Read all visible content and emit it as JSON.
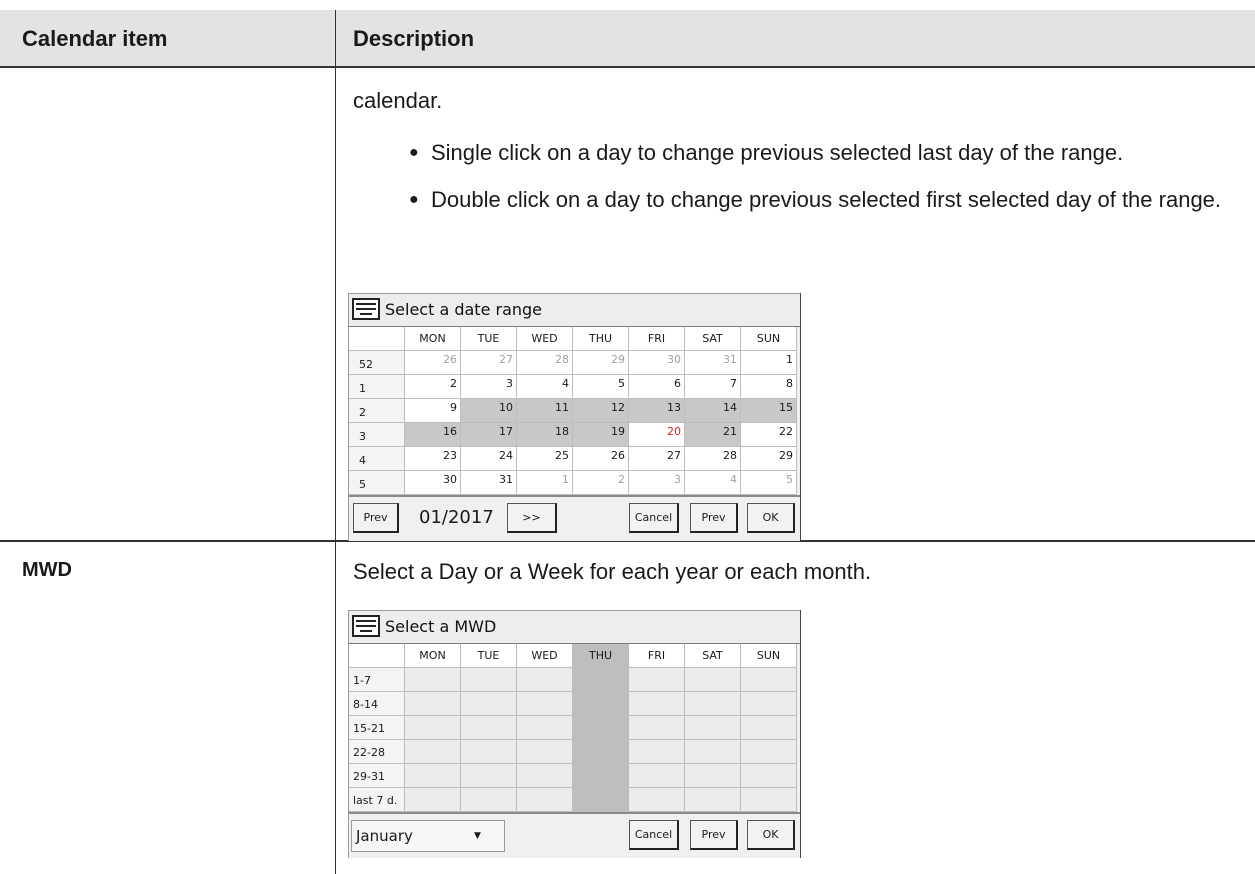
{
  "table": {
    "headers": [
      "Calendar item",
      "Description"
    ]
  },
  "row1": {
    "lead_text": "calendar.",
    "bullets": [
      "Single click on a day to change previous selected last day of the range.",
      "Double click on a day to change previous selected first selected day of the range."
    ]
  },
  "range_widget": {
    "title": "Select a date range",
    "day_headers": [
      "MON",
      "TUE",
      "WED",
      "THU",
      "FRI",
      "SAT",
      "SUN"
    ],
    "weeks": [
      {
        "week": "52",
        "days": [
          "26",
          "27",
          "28",
          "29",
          "30",
          "31",
          "1"
        ]
      },
      {
        "week": "1",
        "days": [
          "2",
          "3",
          "4",
          "5",
          "6",
          "7",
          "8"
        ]
      },
      {
        "week": "2",
        "days": [
          "9",
          "10",
          "11",
          "12",
          "13",
          "14",
          "15"
        ]
      },
      {
        "week": "3",
        "days": [
          "16",
          "17",
          "18",
          "19",
          "20",
          "21",
          "22"
        ]
      },
      {
        "week": "4",
        "days": [
          "23",
          "24",
          "25",
          "26",
          "27",
          "28",
          "29"
        ]
      },
      {
        "week": "5",
        "days": [
          "30",
          "31",
          "1",
          "2",
          "3",
          "4",
          "5"
        ]
      }
    ],
    "prev_left": "Prev",
    "month_year": "01/2017",
    "next": ">>",
    "cancel": "Cancel",
    "prev_right": "Prev",
    "ok": "OK"
  },
  "row2": {
    "item": "MWD",
    "description": "Select a Day or a Week for each year or each month."
  },
  "mwd_widget": {
    "title": "Select a MWD",
    "day_headers": [
      "MON",
      "TUE",
      "WED",
      "THU",
      "FRI",
      "SAT",
      "SUN"
    ],
    "ranges": [
      "1-7",
      "8-14",
      "15-21",
      "22-28",
      "29-31",
      "last 7 d."
    ],
    "month_select": "January",
    "cancel": "Cancel",
    "prev": "Prev",
    "ok": "OK"
  },
  "colors": {
    "header_bg": "#e3e3e3",
    "selected_cell": "#c8c8c8",
    "today": "#e02020"
  },
  "icons": [
    "keyboard-icon",
    "dropdown-arrow-icon"
  ]
}
